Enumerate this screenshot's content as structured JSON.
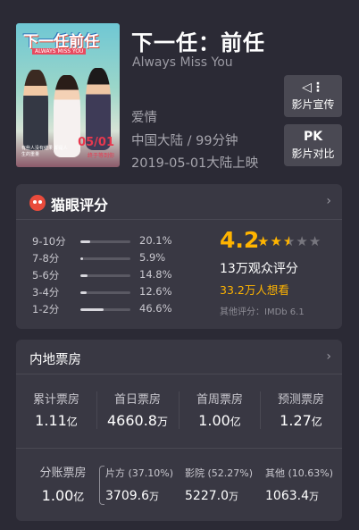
{
  "movie": {
    "title": "下一任：前任",
    "english_title": "Always Miss You",
    "genre": "爱情",
    "region_duration": "中国大陆 / 99分钟",
    "release": "2019-05-01大陆上映",
    "poster": {
      "title": "下一任前任",
      "subtitle": "ALWAYS MISS YOU",
      "date": "05/01",
      "date_sub": "终于等到你",
      "tagline": "有些人没有结果 却是人生的重量"
    }
  },
  "actions": {
    "promo_label": "影片宣传",
    "pk_icon": "PK",
    "pk_label": "影片对比"
  },
  "rating": {
    "header": "猫眼评分",
    "distribution": [
      {
        "label": "9-10分",
        "percent": "20.1%",
        "value": 20.1
      },
      {
        "label": "7-8分",
        "percent": "5.9%",
        "value": 5.9
      },
      {
        "label": "5-6分",
        "percent": "14.8%",
        "value": 14.8
      },
      {
        "label": "3-4分",
        "percent": "12.6%",
        "value": 12.6
      },
      {
        "label": "1-2分",
        "percent": "46.6%",
        "value": 46.6
      }
    ],
    "score": "4.2",
    "stars": 2.5,
    "count": "13万观众评分",
    "want": "33.2万人想看",
    "other": "其他评分：IMDb 6.1"
  },
  "box_office": {
    "header": "内地票房",
    "stats": [
      {
        "label": "累计票房",
        "value": "1.11",
        "unit": "亿"
      },
      {
        "label": "首日票房",
        "value": "4660.8",
        "unit": "万"
      },
      {
        "label": "首周票房",
        "value": "1.00",
        "unit": "亿"
      },
      {
        "label": "预测票房",
        "value": "1.27",
        "unit": "亿"
      }
    ],
    "share": {
      "label": "分账票房",
      "value": "1.00",
      "unit": "亿"
    },
    "split": [
      {
        "label": "片方 (37.10%)",
        "value": "3709.6",
        "unit": "万"
      },
      {
        "label": "影院 (52.27%)",
        "value": "5227.0",
        "unit": "万"
      },
      {
        "label": "其他 (10.63%)",
        "value": "1063.4",
        "unit": "万"
      }
    ]
  },
  "icons": {
    "chevron": "›",
    "star": "★",
    "speaker": "◁⋮"
  },
  "colors": {
    "background": "#2b2a35",
    "card": "#393843",
    "accent": "#ffb400",
    "brand": "#e94b3c"
  }
}
